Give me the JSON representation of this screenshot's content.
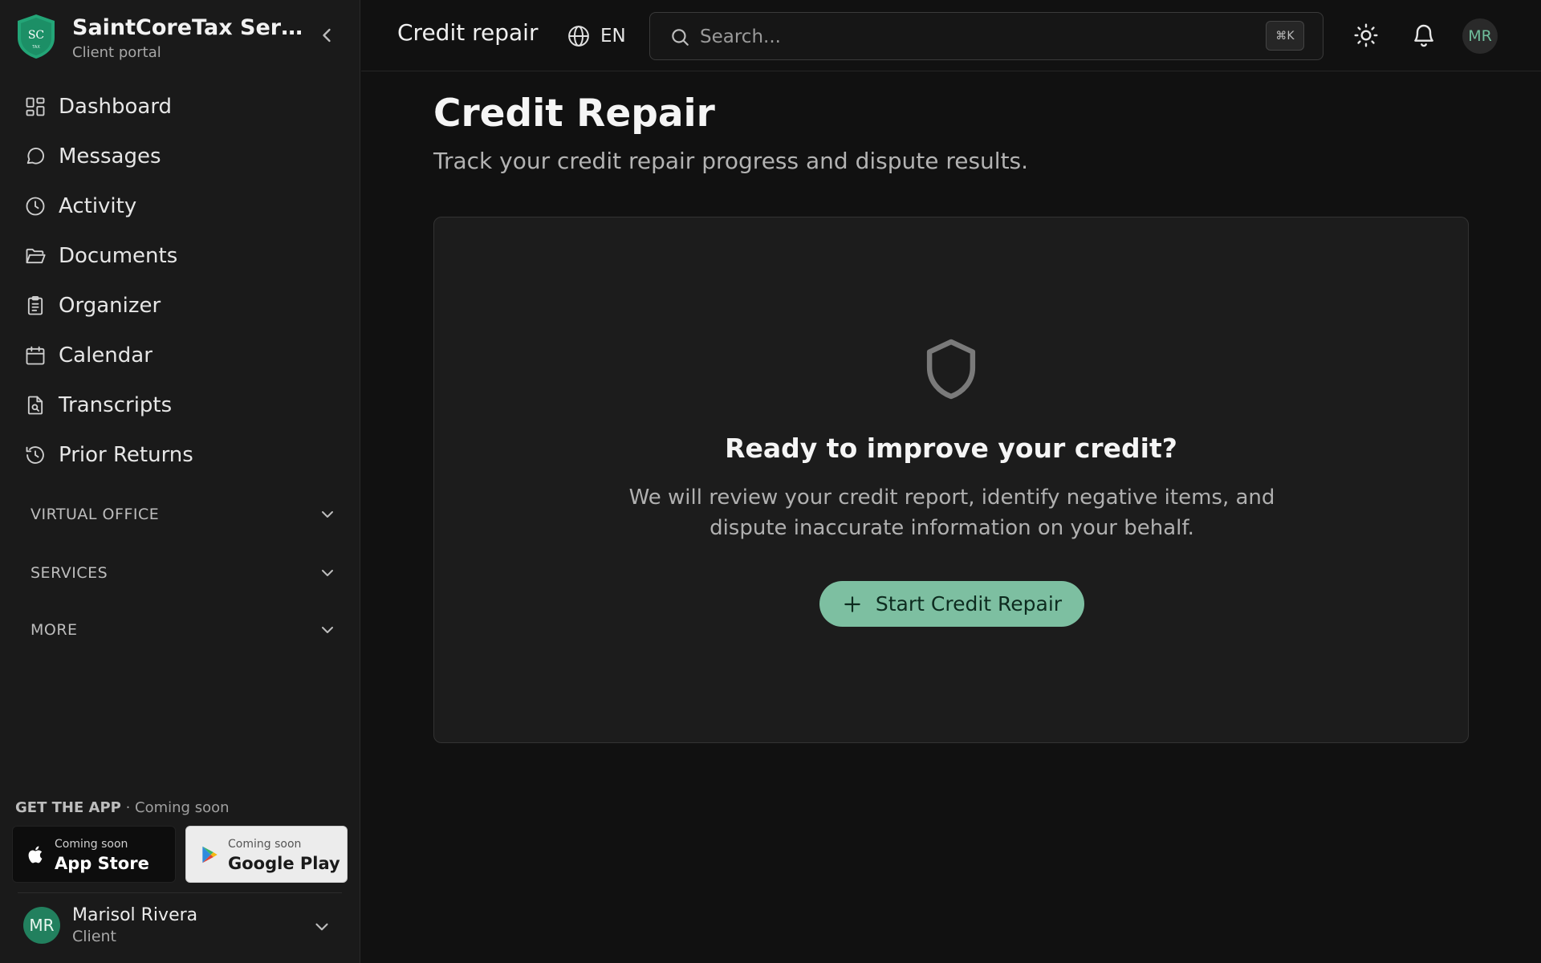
{
  "brand": {
    "logo_text": "SC",
    "logo_sub": "TAX",
    "name": "SaintCoreTax Services",
    "subtitle": "Client portal"
  },
  "sidebar": {
    "items": [
      {
        "label": "Dashboard",
        "icon": "dashboard-icon"
      },
      {
        "label": "Messages",
        "icon": "message-icon"
      },
      {
        "label": "Activity",
        "icon": "clock-icon"
      },
      {
        "label": "Documents",
        "icon": "folder-icon"
      },
      {
        "label": "Organizer",
        "icon": "clipboard-icon"
      },
      {
        "label": "Calendar",
        "icon": "calendar-icon"
      },
      {
        "label": "Transcripts",
        "icon": "file-search-icon"
      },
      {
        "label": "Prior Returns",
        "icon": "history-icon"
      }
    ],
    "sections": [
      {
        "label": "VIRTUAL OFFICE"
      },
      {
        "label": "SERVICES"
      },
      {
        "label": "MORE"
      }
    ],
    "get_app": {
      "title": "GET THE APP",
      "note": "· Coming soon"
    },
    "stores": [
      {
        "small": "Coming soon",
        "name": "App Store",
        "icon": "apple-icon"
      },
      {
        "small": "Coming soon",
        "name": "Google Play",
        "icon": "google-play-icon"
      }
    ],
    "user": {
      "initials": "MR",
      "name": "Marisol Rivera",
      "role": "Client"
    }
  },
  "topbar": {
    "title": "Credit repair",
    "language": "EN",
    "search_placeholder": "Search...",
    "shortcut": "⌘K",
    "avatar_initials": "MR"
  },
  "main": {
    "title": "Credit Repair",
    "subtitle": "Track your credit repair progress and dispute results.",
    "card": {
      "heading": "Ready to improve your credit?",
      "description": "We will review your credit report, identify negative items, and dispute inaccurate information on your behalf.",
      "cta_label": "Start Credit Repair"
    }
  },
  "colors": {
    "background": "#111111",
    "sidebar": "#1a1a1a",
    "accent": "#7dbfa1",
    "avatar": "#22805e"
  }
}
